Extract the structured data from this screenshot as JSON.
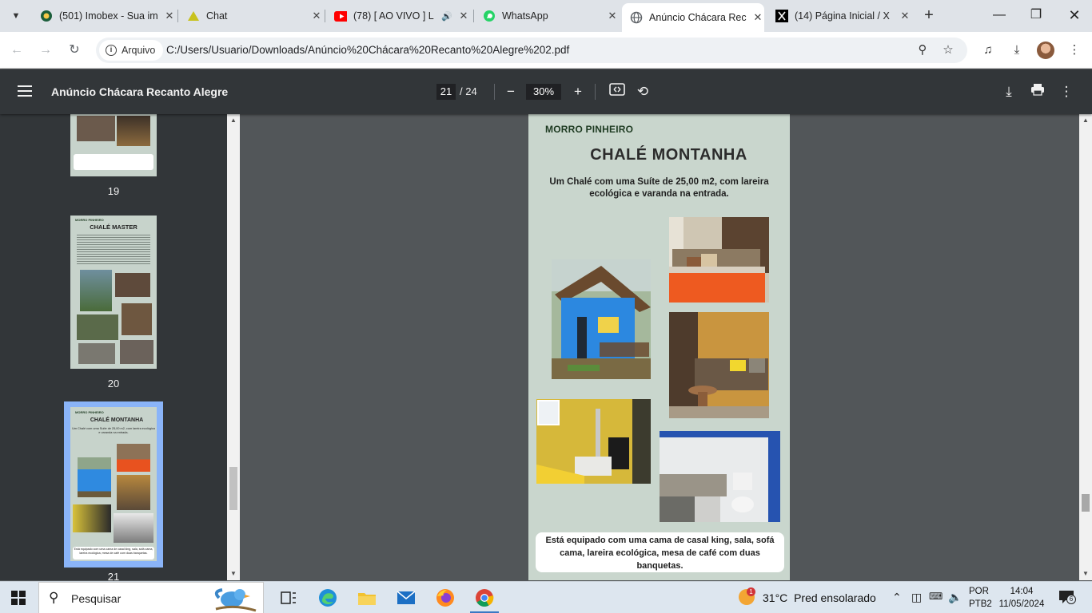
{
  "browser": {
    "tabs": [
      {
        "title": "(501) Imobex - Sua im",
        "icon": "imobex-icon",
        "active": false
      },
      {
        "title": "Chat",
        "icon": "chat-triangle-icon",
        "active": false
      },
      {
        "title": "(78) [ AO VIVO ] L",
        "icon": "youtube-icon",
        "active": false
      },
      {
        "title": "WhatsApp",
        "icon": "whatsapp-icon",
        "active": false
      },
      {
        "title": "Anúncio Chácara Rec",
        "icon": "globe-icon",
        "active": true
      },
      {
        "title": "(14) Página Inicial / X",
        "icon": "x-icon",
        "active": false
      }
    ],
    "site_chip": "Arquivo",
    "url": "C:/Users/Usuario/Downloads/Anúncio%20Chácara%20Recanto%20Alegre%202.pdf"
  },
  "pdf": {
    "doc_title": "Anúncio Chácara Recanto Alegre",
    "current_page": "21",
    "total_pages": "/ 24",
    "zoom": "30%"
  },
  "sidebar": {
    "thumbnails": [
      {
        "number": "19"
      },
      {
        "number": "20",
        "brand": "MORRO PINHEIRO",
        "title": "CHALÉ MASTER"
      },
      {
        "number": "21",
        "brand": "MORRO PINHEIRO",
        "title": "CHALÉ MONTANHA",
        "sub": "Um Chalé com uma Suíte de 25,00 m2, com lareira ecológica e varanda na entrada.",
        "desc": "Está equipado com uma cama de casal king, sala, sofá cama, lareira ecológica, mesa de café com duas banquetas."
      }
    ]
  },
  "page": {
    "brand": "MORRO PINHEIRO",
    "title": "CHALÉ MONTANHA",
    "subtitle": "Um Chalé com uma Suíte de 25,00 m2, com lareira ecológica e varanda na entrada.",
    "description": "Está equipado com uma cama de casal king, sala, sofá cama, lareira ecológica, mesa de café com duas banquetas."
  },
  "taskbar": {
    "search_placeholder": "Pesquisar",
    "weather_temp": "31°C",
    "weather_desc": "Pred ensolarado",
    "weather_badge": "1",
    "lang_line1": "POR",
    "lang_line2": "PTB2",
    "time": "14:04",
    "date": "11/05/2024",
    "notifications": "6"
  },
  "colors": {
    "page_bg": "#c9d6cd",
    "pdf_toolbar": "#323639",
    "viewer_bg": "#525659",
    "thumb_selected": "#8ab4f8"
  }
}
